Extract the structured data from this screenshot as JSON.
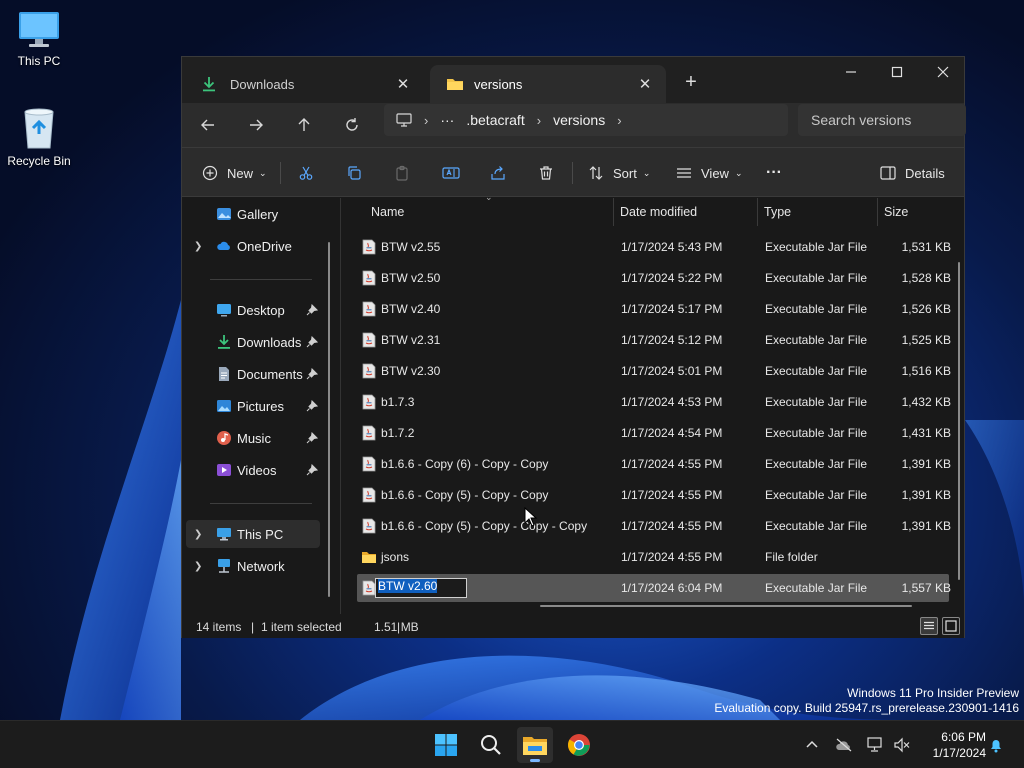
{
  "desktop": {
    "icons": [
      {
        "label": "This PC"
      },
      {
        "label": "Recycle Bin"
      }
    ],
    "watermark": {
      "line1": "Windows 11 Pro Insider Preview",
      "line2": "Evaluation copy. Build 25947.rs_prerelease.230901-1416"
    }
  },
  "explorer": {
    "tabs": [
      {
        "label": "Downloads",
        "icon": "download-icon",
        "active": false
      },
      {
        "label": "versions",
        "icon": "folder-icon",
        "active": true
      }
    ],
    "breadcrumb": {
      "ellipsis": "···",
      "items": [
        ".betacraft",
        "versions"
      ]
    },
    "search_placeholder": "Search versions",
    "toolbar": {
      "new_label": "New",
      "sort_label": "Sort",
      "view_label": "View",
      "more_label": "···",
      "details_label": "Details"
    },
    "sidebar": {
      "top": [
        {
          "label": "Gallery",
          "icon": "gallery-icon"
        },
        {
          "label": "OneDrive",
          "icon": "onedrive-icon"
        }
      ],
      "quick": [
        {
          "label": "Desktop",
          "icon": "desktop-icon"
        },
        {
          "label": "Downloads",
          "icon": "download-icon"
        },
        {
          "label": "Documents",
          "icon": "documents-icon"
        },
        {
          "label": "Pictures",
          "icon": "pictures-icon"
        },
        {
          "label": "Music",
          "icon": "music-icon"
        },
        {
          "label": "Videos",
          "icon": "videos-icon"
        }
      ],
      "bottom": [
        {
          "label": "This PC",
          "icon": "this-pc-icon"
        },
        {
          "label": "Network",
          "icon": "network-icon"
        }
      ]
    },
    "columns": [
      "Name",
      "Date modified",
      "Type",
      "Size"
    ],
    "files": [
      {
        "name": "BTW v2.55",
        "date": "1/17/2024 5:43 PM",
        "type": "Executable Jar File",
        "size": "1,531 KB"
      },
      {
        "name": "BTW v2.50",
        "date": "1/17/2024 5:22 PM",
        "type": "Executable Jar File",
        "size": "1,528 KB"
      },
      {
        "name": "BTW v2.40",
        "date": "1/17/2024 5:17 PM",
        "type": "Executable Jar File",
        "size": "1,526 KB"
      },
      {
        "name": "BTW v2.31",
        "date": "1/17/2024 5:12 PM",
        "type": "Executable Jar File",
        "size": "1,525 KB"
      },
      {
        "name": "BTW v2.30",
        "date": "1/17/2024 5:01 PM",
        "type": "Executable Jar File",
        "size": "1,516 KB"
      },
      {
        "name": "b1.7.3",
        "date": "1/17/2024 4:53 PM",
        "type": "Executable Jar File",
        "size": "1,432 KB"
      },
      {
        "name": "b1.7.2",
        "date": "1/17/2024 4:54 PM",
        "type": "Executable Jar File",
        "size": "1,431 KB"
      },
      {
        "name": "b1.6.6 - Copy (6) - Copy - Copy",
        "date": "1/17/2024 4:55 PM",
        "type": "Executable Jar File",
        "size": "1,391 KB"
      },
      {
        "name": "b1.6.6 - Copy (5) - Copy - Copy",
        "date": "1/17/2024 4:55 PM",
        "type": "Executable Jar File",
        "size": "1,391 KB"
      },
      {
        "name": "b1.6.6 - Copy (5) - Copy - Copy - Copy",
        "date": "1/17/2024 4:55 PM",
        "type": "Executable Jar File",
        "size": "1,391 KB"
      },
      {
        "name": "jsons",
        "date": "1/17/2024 4:55 PM",
        "type": "File folder",
        "size": ""
      }
    ],
    "selected_file": {
      "name": "BTW v2.60",
      "date": "1/17/2024 6:04 PM",
      "type": "Executable Jar File",
      "size": "1,557 KB"
    },
    "status": {
      "items": "14 items",
      "selected": "1 item selected",
      "size": "1.51 MB"
    }
  },
  "taskbar": {
    "apps": [
      "start-icon",
      "search-icon",
      "file-explorer-icon",
      "chrome-icon"
    ],
    "clock": {
      "time": "6:06 PM",
      "date": "1/17/2024"
    }
  },
  "colors": {
    "accent": "#0f5fbf",
    "window_bg": "#191919",
    "chrome_bg": "#2c2c2c"
  }
}
